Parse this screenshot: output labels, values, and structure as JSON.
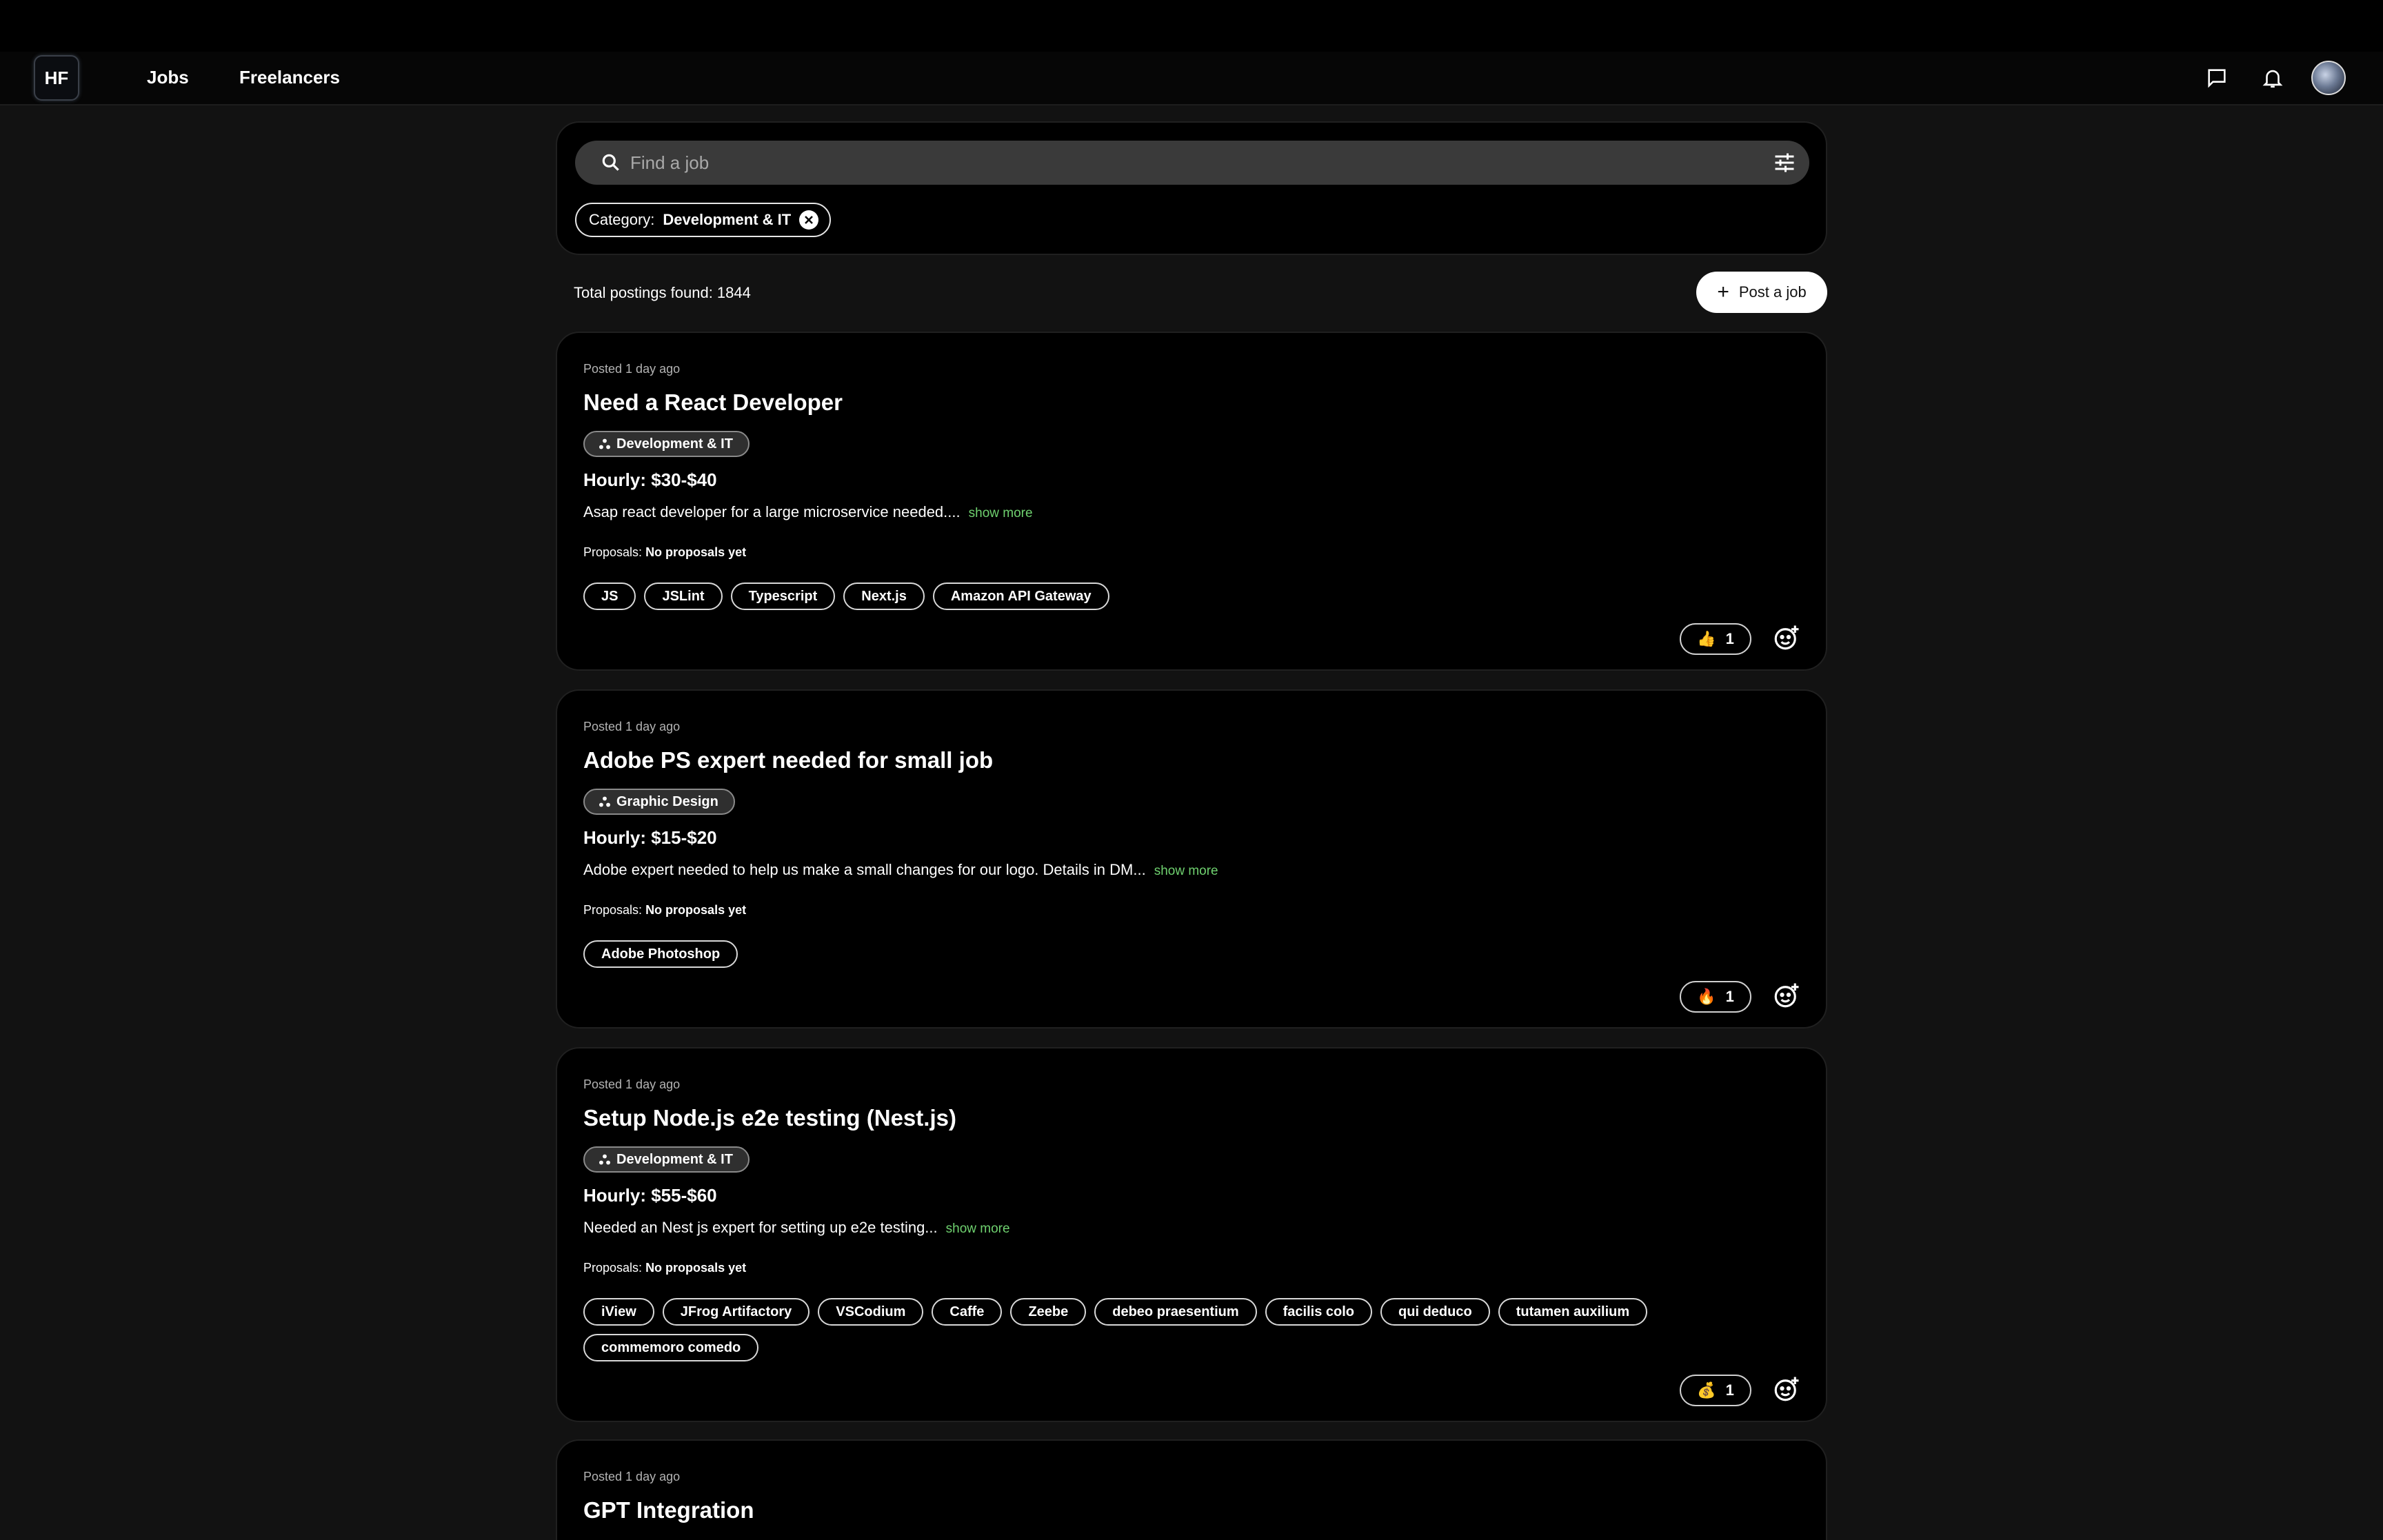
{
  "header": {
    "logo": "HF",
    "nav": [
      "Jobs",
      "Freelancers"
    ],
    "icons": [
      "message-icon",
      "bell-icon",
      "avatar"
    ]
  },
  "search": {
    "placeholder": "Find a job",
    "filter_chip": {
      "key": "Category:",
      "value": "Development & IT"
    }
  },
  "summary": {
    "total_label": "Total postings found: 1844",
    "post_button": "Post a job"
  },
  "jobs": [
    {
      "posted": "Posted 1 day ago",
      "title": "Need a React Developer",
      "category": "Development & IT",
      "rate": "Hourly: $30-$40",
      "description": "Asap react developer for a large microservice needed....",
      "show_more": "show more",
      "proposals_label": "Proposals:",
      "proposals_value": "No proposals yet",
      "skills": [
        "JS",
        "JSLint",
        "Typescript",
        "Next.js",
        "Amazon API Gateway"
      ],
      "reaction": {
        "emoji": "👍",
        "count": "1"
      }
    },
    {
      "posted": "Posted 1 day ago",
      "title": "Adobe PS expert needed for small job",
      "category": "Graphic Design",
      "rate": "Hourly: $15-$20",
      "description": "Adobe expert needed to help us make a small changes for our logo. Details in DM...",
      "show_more": "show more",
      "proposals_label": "Proposals:",
      "proposals_value": "No proposals yet",
      "skills": [
        "Adobe Photoshop"
      ],
      "reaction": {
        "emoji": "🔥",
        "count": "1"
      }
    },
    {
      "posted": "Posted 1 day ago",
      "title": "Setup Node.js e2e testing (Nest.js)",
      "category": "Development & IT",
      "rate": "Hourly: $55-$60",
      "description": "Needed an Nest js expert for setting up e2e testing...",
      "show_more": "show more",
      "proposals_label": "Proposals:",
      "proposals_value": "No proposals yet",
      "skills": [
        "iView",
        "JFrog Artifactory",
        "VSCodium",
        "Caffe",
        "Zeebe",
        "debeo praesentium",
        "facilis colo",
        "qui deduco",
        "tutamen auxilium",
        "commemoro comedo"
      ],
      "reaction": {
        "emoji": "💰",
        "count": "1"
      }
    },
    {
      "posted": "Posted 1 day ago",
      "title": "GPT Integration"
    }
  ]
}
